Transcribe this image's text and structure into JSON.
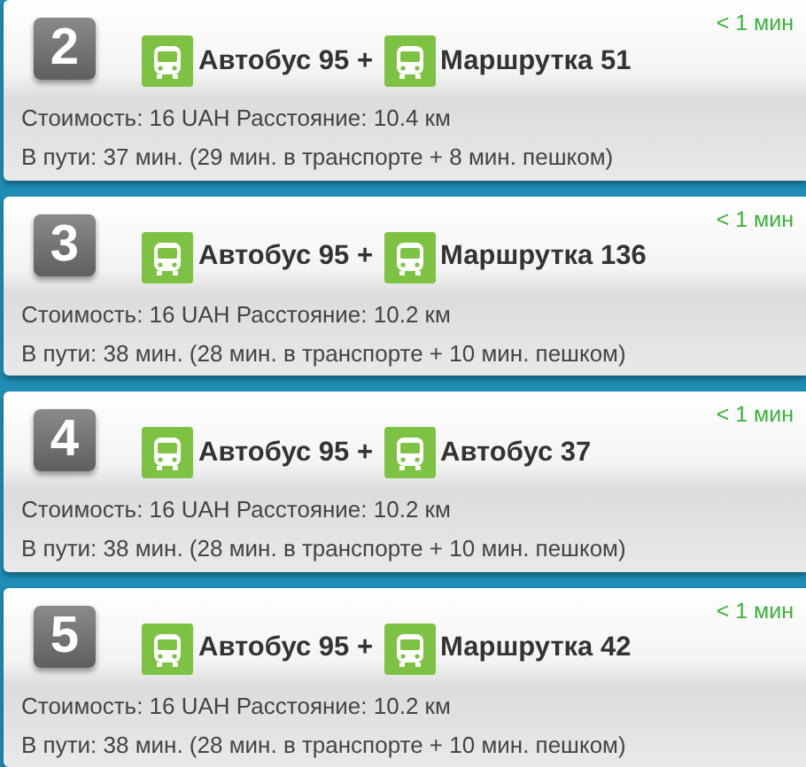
{
  "routes": [
    {
      "number": "2",
      "time": "< 1 мин",
      "legs": [
        "Автобус 95 +",
        "Маршрутка 51"
      ],
      "cost": "Стоимость: 16 UAH Расстояние: 10.4 км",
      "duration": "В пути: 37 мин. (29 мин. в транспорте + 8 мин. пешком)"
    },
    {
      "number": "3",
      "time": "< 1 мин",
      "legs": [
        "Автобус 95 +",
        "Маршрутка 136"
      ],
      "cost": "Стоимость: 16 UAH Расстояние: 10.2 км",
      "duration": "В пути: 38 мин. (28 мин. в транспорте + 10 мин. пешком)"
    },
    {
      "number": "4",
      "time": "< 1 мин",
      "legs": [
        "Автобус 95 +",
        "Автобус 37"
      ],
      "cost": "Стоимость: 16 UAH Расстояние: 10.2 км",
      "duration": "В пути: 38 мин. (28 мин. в транспорте + 10 мин. пешком)"
    },
    {
      "number": "5",
      "time": "< 1 мин",
      "legs": [
        "Автобус 95 +",
        "Маршрутка 42"
      ],
      "cost": "Стоимость: 16 UAH Расстояние: 10.2 км",
      "duration": "В пути: 38 мин. (28 мин. в транспорте + 10 мин. пешком)"
    }
  ]
}
